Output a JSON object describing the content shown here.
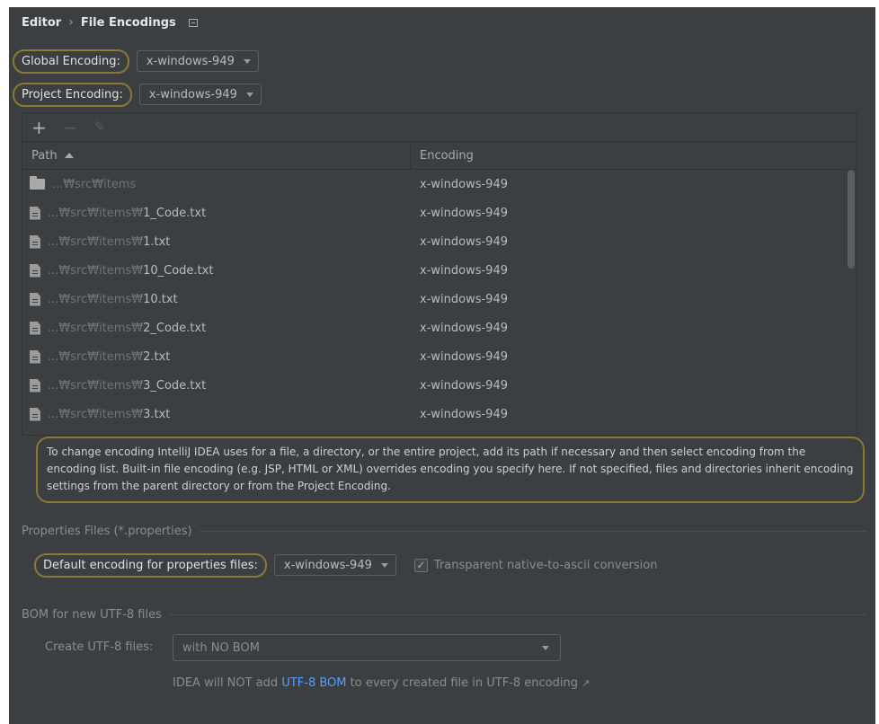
{
  "breadcrumb": {
    "parent": "Editor",
    "separator": "›",
    "current": "File Encodings"
  },
  "global_encoding": {
    "label": "Global Encoding:",
    "value": "x-windows-949"
  },
  "project_encoding": {
    "label": "Project Encoding:",
    "value": "x-windows-949"
  },
  "table": {
    "toolbar": {
      "add": "+",
      "remove": "−",
      "edit": "✎"
    },
    "columns": {
      "path": "Path",
      "encoding": "Encoding"
    },
    "rows": [
      {
        "icon": "folder",
        "prefix": "...₩src₩items",
        "name": "",
        "encoding": "x-windows-949"
      },
      {
        "icon": "file",
        "prefix": "...₩src₩items₩",
        "name": "1_Code.txt",
        "encoding": "x-windows-949"
      },
      {
        "icon": "file",
        "prefix": "...₩src₩items₩",
        "name": "1.txt",
        "encoding": "x-windows-949"
      },
      {
        "icon": "file",
        "prefix": "...₩src₩items₩",
        "name": "10_Code.txt",
        "encoding": "x-windows-949"
      },
      {
        "icon": "file",
        "prefix": "...₩src₩items₩",
        "name": "10.txt",
        "encoding": "x-windows-949"
      },
      {
        "icon": "file",
        "prefix": "...₩src₩items₩",
        "name": "2_Code.txt",
        "encoding": "x-windows-949"
      },
      {
        "icon": "file",
        "prefix": "...₩src₩items₩",
        "name": "2.txt",
        "encoding": "x-windows-949"
      },
      {
        "icon": "file",
        "prefix": "...₩src₩items₩",
        "name": "3_Code.txt",
        "encoding": "x-windows-949"
      },
      {
        "icon": "file",
        "prefix": "...₩src₩items₩",
        "name": "3.txt",
        "encoding": "x-windows-949"
      }
    ]
  },
  "info_text": "To change encoding IntelliJ IDEA uses for a file, a directory, or the entire project, add its path if necessary and then select encoding from the encoding list. Built-in file encoding (e.g. JSP, HTML or XML) overrides encoding you specify here. If not specified, files and directories inherit encoding settings from the parent directory or from the Project Encoding.",
  "properties": {
    "section_title": "Properties Files (*.properties)",
    "default_label": "Default encoding for properties files:",
    "default_value": "x-windows-949",
    "transparent_label": "Transparent native-to-ascii conversion",
    "transparent_checked": true
  },
  "bom": {
    "section_title": "BOM for new UTF-8 files",
    "create_label": "Create UTF-8 files:",
    "create_value": "with NO BOM",
    "hint_before": "IDEA will NOT add ",
    "hint_link": "UTF-8 BOM",
    "hint_after": " to every created file in UTF-8 encoding",
    "hint_ext": "↗"
  },
  "colors": {
    "panel_bg": "#3c3f41",
    "highlight": "#8c7733",
    "link": "#589df6"
  }
}
